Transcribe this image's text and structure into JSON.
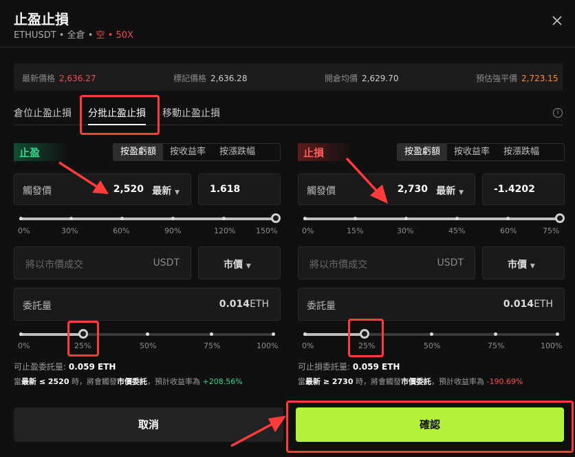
{
  "header": {
    "title": "止盈止損",
    "symbol": "ETHUSDT",
    "sep1": " • ",
    "margin_mode": "全倉",
    "sep2": " • ",
    "side": "空",
    "sep3": " • ",
    "leverage": "50X"
  },
  "prices": {
    "last_label": "最新價格",
    "last_value": "2,636.27",
    "mark_label": "標記價格",
    "mark_value": "2,636.28",
    "entry_label": "開倉均價",
    "entry_value": "2,629.70",
    "liq_label": "預估強平價",
    "liq_value": "2,723.15"
  },
  "tabs": [
    "倉位止盈止損",
    "分批止盈止損",
    "移動止盈止損"
  ],
  "active_tab": 1,
  "take_profit": {
    "tag": "止盈",
    "modes": [
      "按盈虧額",
      "按收益率",
      "按漲跌幅"
    ],
    "trigger_label": "觸發價",
    "trigger_value": "2,520",
    "trigger_type": "最新",
    "pnl_value": "1.618",
    "slider_ticks": [
      "0%",
      "30%",
      "60%",
      "90%",
      "120%",
      "150%"
    ],
    "slider_level_percent": 150,
    "order_placeholder": "將以市價成交",
    "order_unit": "USDT",
    "order_type": "市價",
    "qty_label": "委託量",
    "qty_value": "0.014",
    "qty_unit": "ETH",
    "qty_ticks": [
      "0%",
      "25%",
      "50%",
      "75%",
      "100%"
    ],
    "qty_level_percent": 25,
    "avail_label": "可止盈委託量:",
    "avail_value": "0.059 ETH",
    "note_prefix": "當",
    "note_cond": "最新 ≤ 2520",
    "note_mid": " 時，將會觸發",
    "note_order": "市價委託",
    "note_rest": "，預計收益率為 ",
    "note_ratio": "+208.56%"
  },
  "stop_loss": {
    "tag": "止損",
    "modes": [
      "按盈虧額",
      "按收益率",
      "按漲跌幅"
    ],
    "trigger_label": "觸發價",
    "trigger_value": "2,730",
    "trigger_type": "最新",
    "pnl_value": "-1.4202",
    "slider_ticks": [
      "0%",
      "15%",
      "30%",
      "45%",
      "60%",
      "75%"
    ],
    "slider_level_percent": 75,
    "order_placeholder": "將以市價成交",
    "order_unit": "USDT",
    "order_type": "市價",
    "qty_label": "委託量",
    "qty_value": "0.014",
    "qty_unit": "ETH",
    "qty_ticks": [
      "0%",
      "25%",
      "50%",
      "75%",
      "100%"
    ],
    "qty_level_percent": 25,
    "avail_label": "可止損委託量:",
    "avail_value": "0.059 ETH",
    "note_prefix": "當",
    "note_cond": "最新 ≥ 2730",
    "note_mid": " 時，將會觸發",
    "note_order": "市價委託",
    "note_rest": "，預計收益率為 ",
    "note_ratio": "-190.69%"
  },
  "buttons": {
    "cancel": "取消",
    "confirm": "確認"
  },
  "icons": {
    "close": "close-icon",
    "info": "info-icon",
    "dropdown": "chevron-down-icon"
  },
  "colors": {
    "accent": "#b5f23d",
    "profit": "#2fd98a",
    "loss": "#ff5050",
    "highlight": "#ff3b3b"
  }
}
